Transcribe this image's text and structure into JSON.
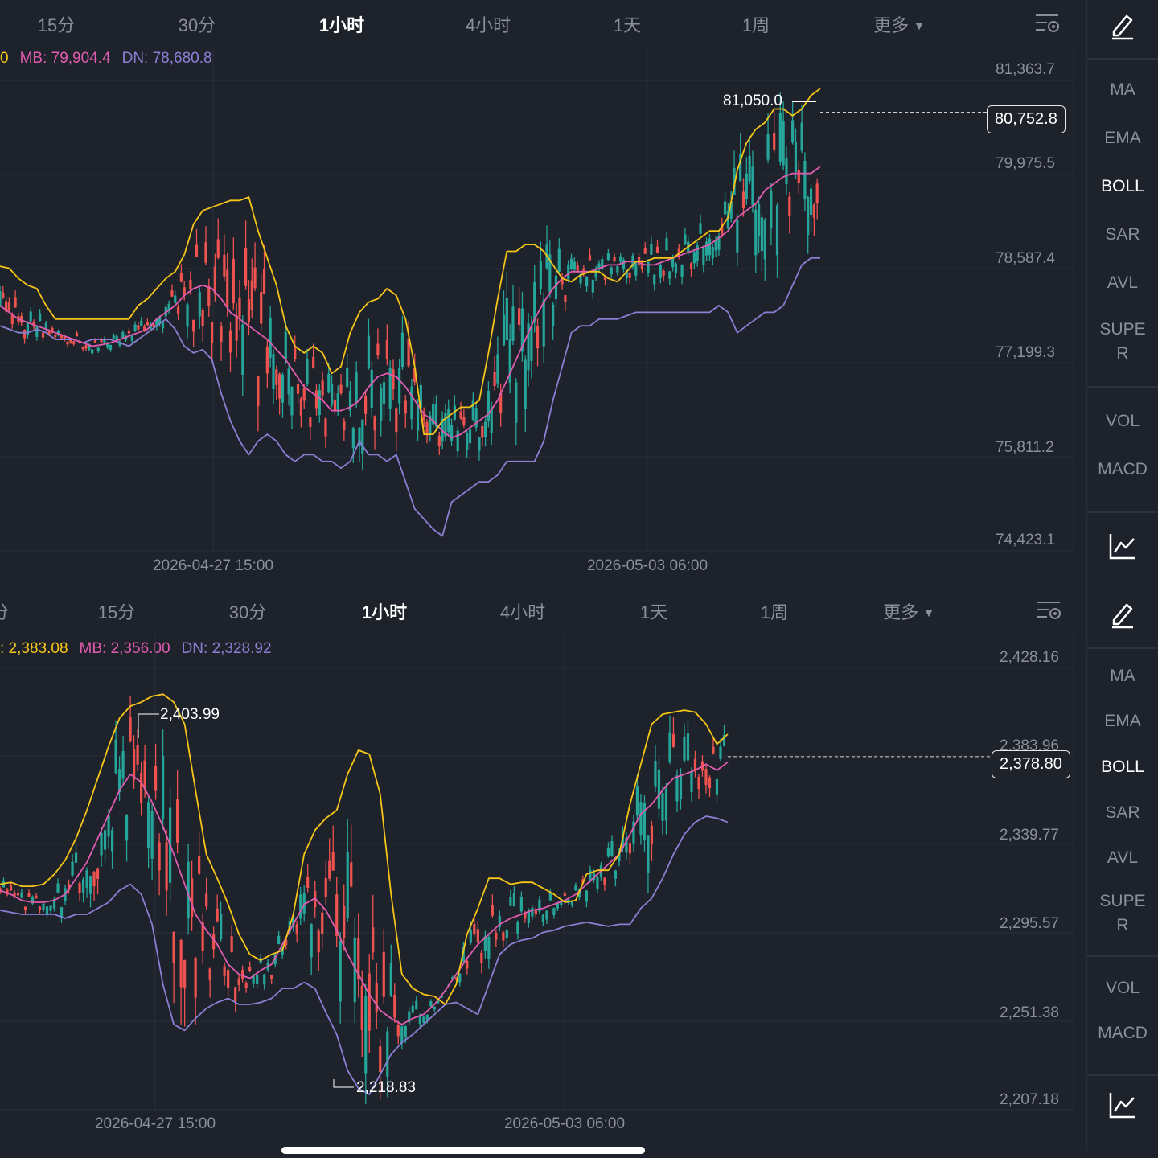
{
  "colors": {
    "background": "#1e222b",
    "grid": "#2a2f3a",
    "up": "#26a69a",
    "down": "#ef5350",
    "upper_band": "#f5c518",
    "middle_band": "#e05cb0",
    "lower_band": "#8b7fd4",
    "text_muted": "#8a8f99",
    "text_active": "#ffffff"
  },
  "top": {
    "tabs": [
      {
        "label": "15分",
        "active": false
      },
      {
        "label": "30分",
        "active": false
      },
      {
        "label": "1小时",
        "active": true
      },
      {
        "label": "4小时",
        "active": false
      },
      {
        "label": "1天",
        "active": false
      },
      {
        "label": "1周",
        "active": false
      },
      {
        "label": "更多",
        "active": false
      }
    ],
    "legend": {
      "up_fragment": "0",
      "mb": "MB: 79,904.4",
      "dn": "DN: 78,680.8"
    },
    "price_label": "80,752.8",
    "peak_label": "81,050.0",
    "y_ticks": [
      "81,363.7",
      "79,975.5",
      "78,587.4",
      "77,199.3",
      "75,811.2",
      "74,423.1"
    ],
    "x_ticks": [
      "2026-04-27 15:00",
      "2026-05-03 06:00"
    ],
    "indicators": [
      "MA",
      "EMA",
      "BOLL",
      "SAR",
      "AVL",
      "SUPE\nR",
      "VOL",
      "MACD"
    ],
    "active_indicator": "BOLL"
  },
  "bottom": {
    "tabs": [
      {
        "label": "15分",
        "active": false
      },
      {
        "label": "30分",
        "active": false
      },
      {
        "label": "1小时",
        "active": true
      },
      {
        "label": "4小时",
        "active": false
      },
      {
        "label": "1天",
        "active": false
      },
      {
        "label": "1周",
        "active": false
      },
      {
        "label": "更多",
        "active": false
      }
    ],
    "legend": {
      "up_fragment": ": 2,383.08",
      "mb": "MB: 2,356.00",
      "dn": "DN: 2,328.92"
    },
    "price_label": "2,378.80",
    "peak_label": "2,403.99",
    "low_label": "2,218.83",
    "y_ticks": [
      "2,428.16",
      "2,383.96",
      "2,339.77",
      "2,295.57",
      "2,251.38",
      "2,207.18"
    ],
    "x_ticks": [
      "2026-04-27 15:00",
      "2026-05-03 06:00"
    ],
    "indicators": [
      "MA",
      "EMA",
      "BOLL",
      "SAR",
      "AVL",
      "SUPE\nR",
      "VOL",
      "MACD"
    ],
    "active_indicator": "BOLL"
  },
  "chart_data": [
    {
      "type": "candlestick",
      "indicator": "BOLL",
      "ylim": [
        74423.1,
        81363.7
      ],
      "y_ticks": [
        81363.7,
        79975.5,
        78587.4,
        77199.3,
        75811.2,
        74423.1
      ],
      "x_ticks": [
        "2026-04-27 15:00",
        "2026-05-03 06:00"
      ],
      "last_price": 80752.8,
      "annotated_high": 81050.0,
      "series": [
        {
          "name": "MB",
          "last": 79904.4
        },
        {
          "name": "DN",
          "last": 78680.8
        }
      ],
      "upper_band": [
        78480,
        78450,
        78300,
        78200,
        78150,
        77900,
        77700,
        77700,
        77700,
        77700,
        77700,
        77700,
        77700,
        77700,
        77700,
        77900,
        78000,
        78150,
        78300,
        78400,
        78650,
        79100,
        79300,
        79350,
        79400,
        79450,
        79450,
        79500,
        79000,
        78600,
        78200,
        77600,
        77300,
        77200,
        77300,
        77200,
        76900,
        77000,
        77500,
        77800,
        77950,
        78000,
        78150,
        78050,
        77700,
        77000,
        76000,
        76000,
        76200,
        76300,
        76400,
        76400,
        76500,
        77200,
        78000,
        78700,
        78700,
        78800,
        78800,
        78700,
        78500,
        78300,
        78250,
        78350,
        78400,
        78400,
        78300,
        78250,
        78400,
        78550,
        78550,
        78600,
        78600,
        78600,
        78700,
        78800,
        78900,
        79000,
        79000,
        79200,
        79900,
        80300,
        80500,
        80600,
        80800,
        80800,
        80700,
        80800,
        81000,
        81100
      ],
      "middle_band": [
        77900,
        77800,
        77700,
        77650,
        77600,
        77550,
        77500,
        77450,
        77400,
        77350,
        77300,
        77320,
        77350,
        77400,
        77450,
        77500,
        77550,
        77700,
        77800,
        77900,
        78050,
        78150,
        78200,
        78150,
        78000,
        77800,
        77700,
        77600,
        77500,
        77400,
        77250,
        77100,
        76900,
        76700,
        76600,
        76500,
        76350,
        76350,
        76400,
        76500,
        76700,
        76850,
        76900,
        76850,
        76700,
        76500,
        76300,
        76200,
        76050,
        75950,
        76000,
        76100,
        76200,
        76300,
        76500,
        76800,
        77100,
        77400,
        77700,
        77950,
        78150,
        78300,
        78400,
        78400,
        78400,
        78450,
        78500,
        78500,
        78550,
        78550,
        78500,
        78500,
        78550,
        78600,
        78650,
        78700,
        78750,
        78800,
        78900,
        79000,
        79200,
        79300,
        79400,
        79600,
        79700,
        79800,
        79850,
        79850,
        79850,
        79950
      ],
      "lower_band": [
        77600,
        77550,
        77500,
        77500,
        77550,
        77500,
        77400,
        77400,
        77400,
        77350,
        77400,
        77400,
        77400,
        77350,
        77300,
        77400,
        77500,
        77600,
        77700,
        77550,
        77300,
        77200,
        77250,
        77100,
        76600,
        76200,
        75900,
        75700,
        75900,
        76000,
        75900,
        75700,
        75600,
        75700,
        75700,
        75600,
        75600,
        75500,
        75600,
        75900,
        75700,
        75700,
        75600,
        75700,
        75300,
        74900,
        74750,
        74600,
        74500,
        75000,
        75100,
        75200,
        75300,
        75300,
        75400,
        75600,
        75600,
        75600,
        75600,
        75900,
        76500,
        77000,
        77500,
        77600,
        77600,
        77700,
        77700,
        77700,
        77750,
        77800,
        77800,
        77800,
        77800,
        77800,
        77800,
        77800,
        77800,
        77800,
        77900,
        77800,
        77500,
        77600,
        77700,
        77800,
        77800,
        77900,
        78200,
        78500,
        78600,
        78600
      ]
    },
    {
      "type": "candlestick",
      "indicator": "BOLL",
      "ylim": [
        2207.18,
        2428.16
      ],
      "y_ticks": [
        2428.16,
        2383.96,
        2339.77,
        2295.57,
        2251.38,
        2207.18
      ],
      "x_ticks": [
        "2026-04-27 15:00",
        "2026-05-03 06:00"
      ],
      "last_price": 2378.8,
      "annotated_high": 2403.99,
      "annotated_low": 2218.83,
      "series": [
        {
          "name": "MB",
          "last": 2356.0
        },
        {
          "name": "DN",
          "last": 2328.92
        }
      ],
      "upper_band": [
        2315,
        2316,
        2314,
        2314,
        2315,
        2320,
        2327,
        2338,
        2352,
        2368,
        2384,
        2398,
        2404,
        2406,
        2409,
        2410,
        2406,
        2395,
        2362,
        2330,
        2318,
        2305,
        2290,
        2280,
        2277,
        2280,
        2282,
        2300,
        2330,
        2342,
        2348,
        2352,
        2370,
        2382,
        2380,
        2360,
        2310,
        2270,
        2263,
        2260,
        2259,
        2255,
        2265,
        2290,
        2303,
        2318,
        2318,
        2315,
        2316,
        2316,
        2313,
        2310,
        2306,
        2307,
        2320,
        2322,
        2322,
        2330,
        2355,
        2375,
        2395,
        2400,
        2401,
        2402,
        2401,
        2395,
        2385,
        2390
      ],
      "middle_band": [
        2312,
        2310,
        2307,
        2306,
        2306,
        2307,
        2310,
        2318,
        2326,
        2338,
        2350,
        2362,
        2370,
        2366,
        2356,
        2344,
        2330,
        2315,
        2300,
        2292,
        2285,
        2275,
        2270,
        2268,
        2272,
        2275,
        2285,
        2295,
        2305,
        2308,
        2302,
        2292,
        2280,
        2270,
        2260,
        2252,
        2248,
        2245,
        2248,
        2250,
        2255,
        2262,
        2270,
        2278,
        2285,
        2290,
        2295,
        2298,
        2300,
        2302,
        2303,
        2305,
        2307,
        2310,
        2315,
        2320,
        2325,
        2330,
        2340,
        2350,
        2355,
        2362,
        2368,
        2370,
        2372,
        2375,
        2372,
        2376
      ],
      "lower_band": [
        2302,
        2301,
        2300,
        2300,
        2300,
        2300,
        2298,
        2300,
        2300,
        2303,
        2306,
        2312,
        2315,
        2310,
        2295,
        2265,
        2245,
        2242,
        2248,
        2253,
        2256,
        2258,
        2255,
        2255,
        2256,
        2258,
        2263,
        2263,
        2266,
        2263,
        2251,
        2240,
        2222,
        2213,
        2210,
        2220,
        2230,
        2236,
        2240,
        2245,
        2250,
        2255,
        2256,
        2253,
        2250,
        2265,
        2280,
        2285,
        2287,
        2288,
        2291,
        2292,
        2294,
        2295,
        2296,
        2295,
        2294,
        2295,
        2295,
        2303,
        2308,
        2318,
        2330,
        2340,
        2346,
        2349,
        2348,
        2346
      ]
    }
  ]
}
